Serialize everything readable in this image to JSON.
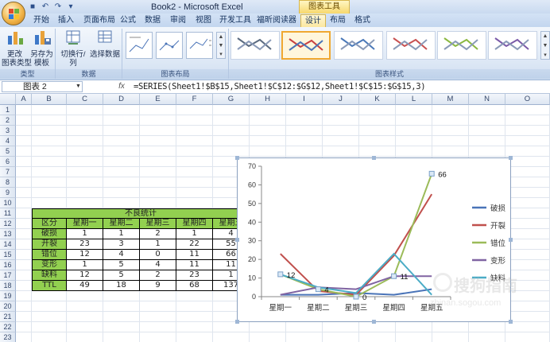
{
  "title_bar": {
    "window_title": "Book2 - Microsoft Excel",
    "context_title": "图表工具"
  },
  "tabs": [
    {
      "label": "开始",
      "active": false
    },
    {
      "label": "插入",
      "active": false
    },
    {
      "label": "页面布局",
      "active": false
    },
    {
      "label": "公式",
      "active": false
    },
    {
      "label": "数据",
      "active": false
    },
    {
      "label": "审阅",
      "active": false
    },
    {
      "label": "视图",
      "active": false
    },
    {
      "label": "开发工具",
      "active": false
    },
    {
      "label": "福昕阅读器",
      "active": false
    },
    {
      "label": "设计",
      "active": true
    },
    {
      "label": "布局",
      "active": false
    },
    {
      "label": "格式",
      "active": false
    }
  ],
  "ribbon": {
    "groups": {
      "type": "类型",
      "data": "数据",
      "layout": "图表布局",
      "styles": "图表样式"
    },
    "buttons": {
      "change_type": "更改\n图表类型",
      "save_template": "另存为\n模板",
      "switch_row_col": "切换行/列",
      "select_data": "选择数据"
    },
    "style_colors": [
      "#5a6a80",
      "#c84040",
      "#4a78b8",
      "#c85050",
      "#8ab840",
      "#7a5aa8"
    ]
  },
  "formula_bar": {
    "name_box": "图表 2",
    "fx": "fx",
    "formula": "=SERIES(Sheet1!$B$15,Sheet1!$C$12:$G$12,Sheet1!$C$15:$G$15,3)"
  },
  "columns": [
    "A",
    "B",
    "C",
    "D",
    "E",
    "F",
    "G",
    "H",
    "I",
    "J",
    "K",
    "L",
    "M",
    "N",
    "O"
  ],
  "rows": [
    "1",
    "2",
    "3",
    "4",
    "5",
    "6",
    "7",
    "8",
    "9",
    "10",
    "11",
    "12",
    "13",
    "14",
    "15",
    "16",
    "17",
    "18",
    "19",
    "20",
    "21",
    "22",
    "23"
  ],
  "table": {
    "title": "不良统计",
    "header": [
      "区分",
      "星期一",
      "星期二",
      "星期三",
      "星期四",
      "星期五"
    ],
    "rows": [
      [
        "破损",
        "1",
        "1",
        "2",
        "1",
        "4"
      ],
      [
        "开裂",
        "23",
        "3",
        "1",
        "22",
        "55"
      ],
      [
        "错位",
        "12",
        "4",
        "0",
        "11",
        "66"
      ],
      [
        "变形",
        "1",
        "5",
        "4",
        "11",
        "11"
      ],
      [
        "缺料",
        "12",
        "5",
        "2",
        "23",
        "1"
      ],
      [
        "TTL",
        "49",
        "18",
        "9",
        "68",
        "137"
      ]
    ]
  },
  "chart_data": {
    "type": "line",
    "categories": [
      "星期一",
      "星期二",
      "星期三",
      "星期四",
      "星期五"
    ],
    "ylim": [
      0,
      70
    ],
    "yticks": [
      0,
      10,
      20,
      30,
      40,
      50,
      60,
      70
    ],
    "series": [
      {
        "name": "破损",
        "values": [
          1,
          1,
          2,
          1,
          4
        ],
        "color": "#4a74b8"
      },
      {
        "name": "开裂",
        "values": [
          23,
          3,
          1,
          22,
          55
        ],
        "color": "#c0504d"
      },
      {
        "name": "错位",
        "values": [
          12,
          4,
          0,
          11,
          66
        ],
        "color": "#9bbb59"
      },
      {
        "name": "变形",
        "values": [
          1,
          5,
          4,
          11,
          11
        ],
        "color": "#8064a2"
      },
      {
        "name": "缺料",
        "values": [
          12,
          5,
          2,
          23,
          1
        ],
        "color": "#4bacc6"
      }
    ],
    "data_labels": {
      "series": "错位",
      "values": [
        "12",
        "4",
        "0",
        "11",
        "66"
      ]
    },
    "legend": "right",
    "grid": false
  },
  "watermark": {
    "brand": "搜狗指南",
    "url": "zhinan.sogou.com"
  }
}
